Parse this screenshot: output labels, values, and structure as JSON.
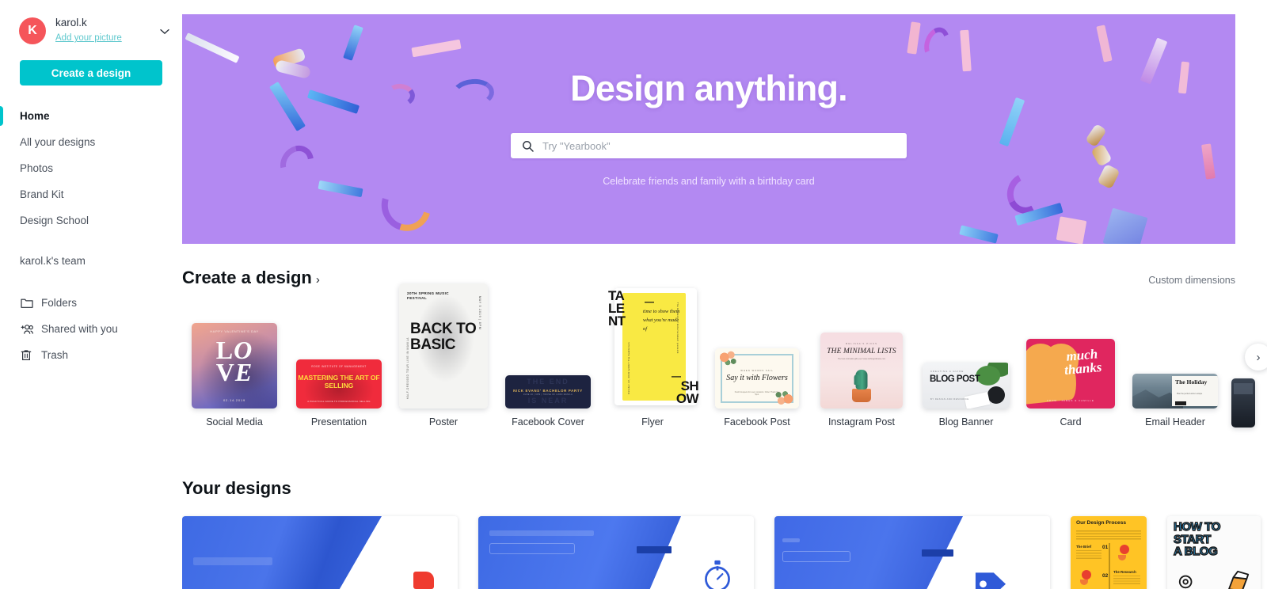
{
  "sidebar": {
    "user": {
      "name": "karol.k",
      "add_picture": "Add your picture",
      "avatar_initial": "K",
      "avatar_color": "#f5555a"
    },
    "cta_label": "Create a design",
    "nav": [
      {
        "label": "Home",
        "active": true
      },
      {
        "label": "All your designs",
        "active": false
      },
      {
        "label": "Photos",
        "active": false
      },
      {
        "label": "Brand Kit",
        "active": false
      },
      {
        "label": "Design School",
        "active": false
      }
    ],
    "team_label": "karol.k's team",
    "nav_icons": [
      {
        "label": "Folders",
        "icon": "folder-icon"
      },
      {
        "label": "Shared with you",
        "icon": "shared-people-icon"
      },
      {
        "label": "Trash",
        "icon": "trash-icon"
      }
    ],
    "accent_color": "#00c4cc"
  },
  "hero": {
    "title": "Design anything.",
    "search_placeholder": "Try \"Yearbook\"",
    "search_value": "",
    "search_icon": "search-icon",
    "subtitle": "Celebrate friends and family with a birthday card",
    "background_color": "#b389f2"
  },
  "create_section": {
    "title": "Create a design",
    "arrow": "›",
    "custom_dimensions": "Custom dimensions",
    "next_arrow": "›",
    "tiles": [
      {
        "label": "Social Media",
        "kind": "social-media"
      },
      {
        "label": "Presentation",
        "kind": "presentation"
      },
      {
        "label": "Poster",
        "kind": "poster"
      },
      {
        "label": "Facebook Cover",
        "kind": "facebook-cover"
      },
      {
        "label": "Flyer",
        "kind": "flyer"
      },
      {
        "label": "Facebook Post",
        "kind": "facebook-post"
      },
      {
        "label": "Instagram Post",
        "kind": "instagram-post"
      },
      {
        "label": "Blog Banner",
        "kind": "blog-banner"
      },
      {
        "label": "Card",
        "kind": "card"
      },
      {
        "label": "Email Header",
        "kind": "email-header"
      }
    ],
    "thumb_text": {
      "social_media": {
        "top": "HAPPY VALENTINE'S DAY",
        "big": "LOVE",
        "date": "02.14.2019"
      },
      "presentation": {
        "top": "ROSE INSTITUTE OF MANAGEMENT",
        "title": "MASTERING THE ART OF SELLING",
        "bottom": "A PRACTICAL GUIDE TO PROFESSIONAL SELLING"
      },
      "poster": {
        "top": "20TH SPRING MUSIC FESTIVAL",
        "big": "BACK TO BASIC",
        "side": "MAY 5 2019 | 8PM",
        "bl": "HALF-DRESSED TOUR LIVE IN MANILA"
      },
      "facebook_cover": {
        "ghost": "THE END",
        "title": "NICK EVANS' BACHELOR PARTY",
        "ghost2": "IS NEAR"
      },
      "flyer": {
        "ta": "TA",
        "le": "LE",
        "nt": "NT",
        "dash1": "—",
        "script": "time to show them what you're made of",
        "dash2": "—",
        "sh": "SH",
        "ow": "OW",
        "side": "The Academy of Entertainment presents"
      },
      "facebook_post": {
        "top": "WHEN WORDS FAIL",
        "title": "Say it with Flowers",
        "sub": "Fresh bouquets for every occasion. Order. Thank You Spot."
      },
      "instagram_post": {
        "top": "MELISSA'S PICKS",
        "title": "THE MINIMAL LISTS",
        "sub": "The best minimalist gifts ever! www.nothingordinaire.com"
      },
      "blog_banner": {
        "top": "CREATING A GUIDE",
        "big": "BLOG POST",
        "sub": "BY DESIGN AND RESOURCE"
      },
      "card": {
        "script1": "much",
        "script2": "thanks",
        "from": "FROM : JAMES & CAMILLE"
      },
      "email_header": {
        "title": "The Holiday",
        "sub": "Plan the perfect winter escape"
      }
    }
  },
  "your_designs": {
    "title": "Your designs",
    "cards": [
      {
        "kind": "presentation-flag",
        "icon": "flag-icon"
      },
      {
        "kind": "presentation-stopwatch",
        "icon": "stopwatch-icon"
      },
      {
        "kind": "presentation-tag",
        "icon": "tag-icon"
      },
      {
        "kind": "infographic",
        "title": "Our Design Process",
        "step1_label": "The Brief",
        "step1_num": "01",
        "step2_label": "The Research",
        "step2_num": "02"
      },
      {
        "kind": "blog-graphic",
        "l1": "HOW TO",
        "l2": "START",
        "l3": "A BLOG"
      }
    ]
  }
}
